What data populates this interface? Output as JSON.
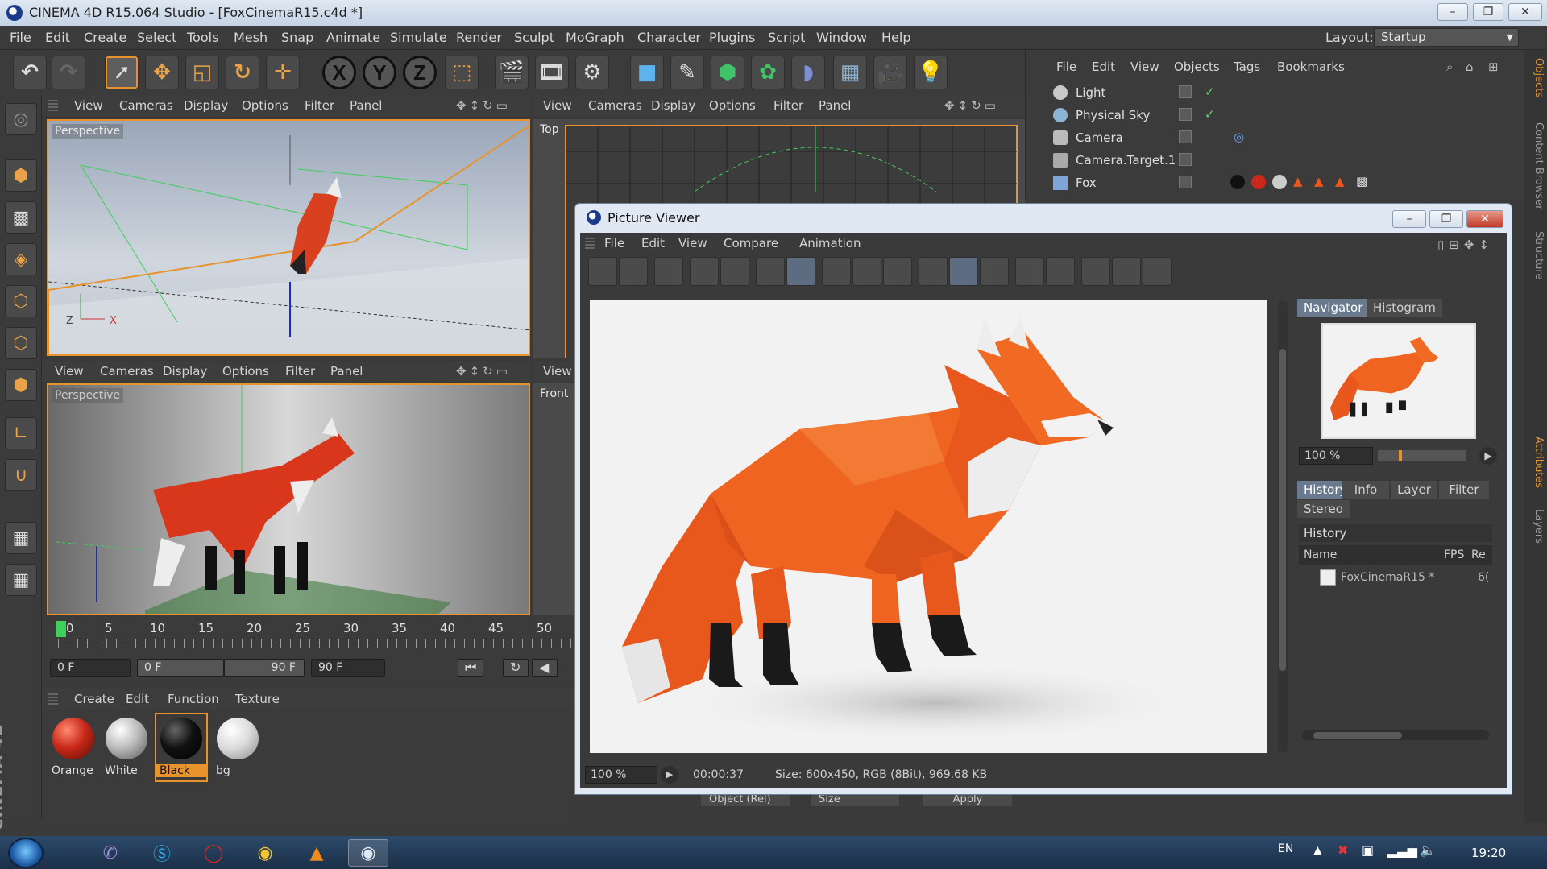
{
  "window": {
    "title": "CINEMA 4D R15.064 Studio - [FoxCinemaR15.c4d *]",
    "min": "–",
    "max": "❐",
    "close": "✕"
  },
  "menubar": [
    "File",
    "Edit",
    "Create",
    "Select",
    "Tools",
    "Mesh",
    "Snap",
    "Animate",
    "Simulate",
    "Render",
    "Sculpt",
    "MoGraph",
    "Character",
    "Plugins",
    "Script",
    "Window",
    "Help"
  ],
  "layout": {
    "label": "Layout:",
    "value": "Startup"
  },
  "viewport_menu": [
    "View",
    "Cameras",
    "Display",
    "Options",
    "Filter",
    "Panel"
  ],
  "viewports": {
    "top_left_label": "Perspective",
    "top_right_label": "Top",
    "bottom_left_label": "Perspective",
    "bottom_right_label": "Front",
    "bottom_right_menu": "View"
  },
  "object_manager": {
    "menu": [
      "File",
      "Edit",
      "View",
      "Objects",
      "Tags",
      "Bookmarks"
    ],
    "objects": [
      "Light",
      "Physical Sky",
      "Camera",
      "Camera.Target.1",
      "Fox"
    ]
  },
  "right_tabs": [
    "Objects",
    "Content Browser",
    "Structure",
    "Attributes",
    "Layers"
  ],
  "timeline": {
    "ticks": [
      "0",
      "5",
      "10",
      "15",
      "20",
      "25",
      "30",
      "35",
      "40",
      "45",
      "50"
    ],
    "current_frame": "0 F",
    "range_start": "0 F",
    "range_end": "90 F",
    "end_frame": "90 F"
  },
  "material_manager": {
    "menu": [
      "Create",
      "Edit",
      "Function",
      "Texture"
    ],
    "materials": [
      {
        "name": "Orange",
        "color": "#c9281a"
      },
      {
        "name": "White",
        "color": "#d8d8d8"
      },
      {
        "name": "Black",
        "color": "#111111"
      },
      {
        "name": "bg",
        "color": "#e6e6e6"
      }
    ]
  },
  "attributes_bottom": {
    "object_rel": "Object (Rel)",
    "size": "Size",
    "apply": "Apply"
  },
  "picture_viewer": {
    "title": "Picture Viewer",
    "menu": [
      "File",
      "Edit",
      "View",
      "Compare",
      "Animation"
    ],
    "nav_tabs": [
      "Navigator",
      "Histogram"
    ],
    "zoom": "100 %",
    "info_tabs": [
      "History",
      "Info",
      "Layer",
      "Filter",
      "Stereo"
    ],
    "history_header": "History",
    "columns": [
      "Name",
      "FPS",
      "Re"
    ],
    "history_row": {
      "name": "FoxCinemaR15 *",
      "fps": "6("
    },
    "status_zoom": "100 %",
    "status_time": "00:00:37",
    "status_info": "Size: 600x450, RGB (8Bit), 969.68 KB"
  },
  "taskbar": {
    "lang": "EN",
    "time": "19:20"
  },
  "colors": {
    "accent": "#e8932b",
    "fox_orange": "#e8581c",
    "panel": "#3b3b3b"
  }
}
